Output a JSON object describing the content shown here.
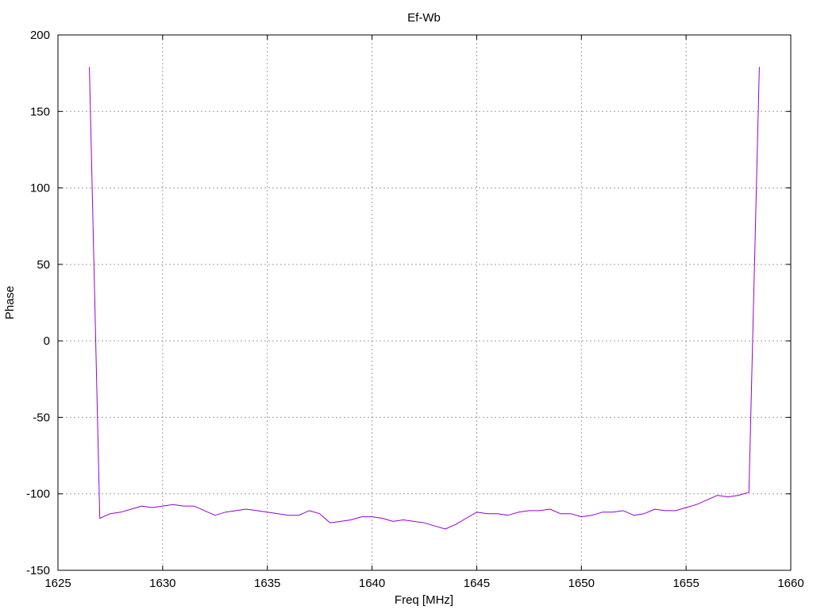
{
  "chart_data": {
    "type": "line",
    "title": "Ef-Wb",
    "xlabel": "Freq [MHz]",
    "ylabel": "Phase",
    "xlim": [
      1625,
      1660
    ],
    "ylim": [
      -150,
      200
    ],
    "xticks": [
      1625,
      1630,
      1635,
      1640,
      1645,
      1650,
      1655,
      1660
    ],
    "yticks": [
      -150,
      -100,
      -50,
      0,
      50,
      100,
      150,
      200
    ],
    "grid": true,
    "legend": "none",
    "series": [
      {
        "color": "#9400D3",
        "x": [
          1626.5,
          1627.0,
          1627.5,
          1628.0,
          1628.5,
          1629.0,
          1629.5,
          1630.0,
          1630.5,
          1631.0,
          1631.5,
          1632.0,
          1632.5,
          1633.0,
          1633.5,
          1634.0,
          1634.5,
          1635.0,
          1635.5,
          1636.0,
          1636.5,
          1637.0,
          1637.5,
          1638.0,
          1638.5,
          1639.0,
          1639.5,
          1640.0,
          1640.5,
          1641.0,
          1641.5,
          1642.0,
          1642.5,
          1643.0,
          1643.5,
          1644.0,
          1644.5,
          1645.0,
          1645.5,
          1646.0,
          1646.5,
          1647.0,
          1647.5,
          1648.0,
          1648.5,
          1649.0,
          1649.5,
          1650.0,
          1650.5,
          1651.0,
          1651.5,
          1652.0,
          1652.5,
          1653.0,
          1653.5,
          1654.0,
          1654.5,
          1655.0,
          1655.5,
          1656.0,
          1656.5,
          1657.0,
          1657.5,
          1658.0,
          1658.5
        ],
        "y": [
          179,
          -116,
          -113,
          -112,
          -110,
          -108,
          -109,
          -108,
          -107,
          -108,
          -108,
          -111,
          -114,
          -112,
          -111,
          -110,
          -111,
          -112,
          -113,
          -114,
          -114,
          -111,
          -113,
          -119,
          -118,
          -117,
          -115,
          -115,
          -116,
          -118,
          -117,
          -118,
          -119,
          -121,
          -123,
          -120,
          -116,
          -112,
          -113,
          -113,
          -114,
          -112,
          -111,
          -111,
          -110,
          -113,
          -113,
          -115,
          -114,
          -112,
          -112,
          -111,
          -114,
          -113,
          -110,
          -111,
          -111,
          -109,
          -107,
          -104,
          -101,
          -102,
          -101,
          -99,
          179
        ]
      }
    ]
  }
}
